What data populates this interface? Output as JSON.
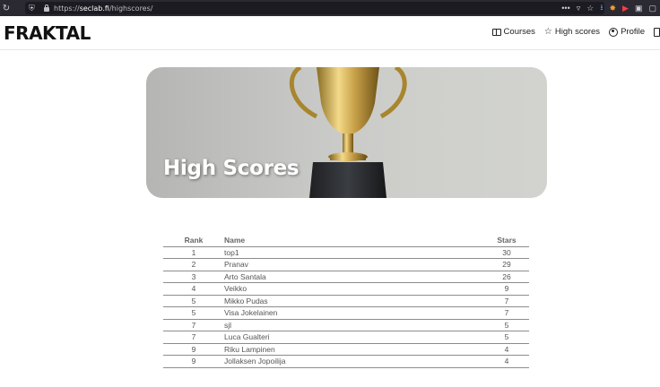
{
  "browser": {
    "url_prefix": "https://",
    "url_host": "seclab.fi",
    "url_path": "/highscores/",
    "menu_dots": "•••"
  },
  "site": {
    "logo": "FRAKTAL",
    "nav": {
      "courses": "Courses",
      "highscores": "High scores",
      "profile": "Profile"
    }
  },
  "hero": {
    "title": "High Scores"
  },
  "table": {
    "headers": {
      "rank": "Rank",
      "name": "Name",
      "stars": "Stars"
    },
    "rows": [
      {
        "rank": "1",
        "name": "top1",
        "stars": "30"
      },
      {
        "rank": "2",
        "name": "Pranav",
        "stars": "29"
      },
      {
        "rank": "3",
        "name": "Arto Santala",
        "stars": "26"
      },
      {
        "rank": "4",
        "name": "Veikko",
        "stars": "9"
      },
      {
        "rank": "5",
        "name": "Mikko Pudas",
        "stars": "7"
      },
      {
        "rank": "5",
        "name": "Visa Jokelainen",
        "stars": "7"
      },
      {
        "rank": "7",
        "name": "sjl",
        "stars": "5"
      },
      {
        "rank": "7",
        "name": "Luca Gualteri",
        "stars": "5"
      },
      {
        "rank": "9",
        "name": "Riku Lampinen",
        "stars": "4"
      },
      {
        "rank": "9",
        "name": "Jollaksen Jopoilija",
        "stars": "4"
      }
    ]
  }
}
